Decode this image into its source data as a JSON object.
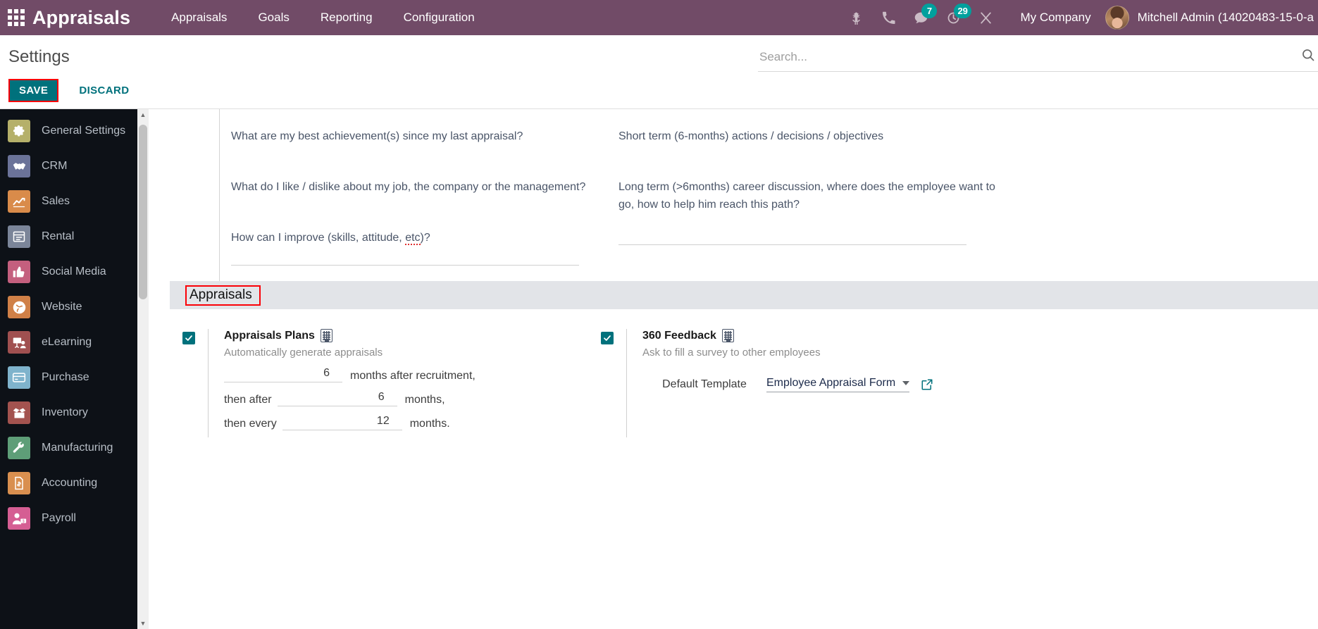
{
  "navbar": {
    "apps_icon": "apps-grid-icon",
    "brand": "Appraisals",
    "menu": [
      {
        "label": "Appraisals"
      },
      {
        "label": "Goals"
      },
      {
        "label": "Reporting"
      },
      {
        "label": "Configuration"
      }
    ],
    "sys_icons": [
      {
        "name": "bug-icon",
        "badge": null
      },
      {
        "name": "phone-icon",
        "badge": null
      },
      {
        "name": "chat-icon",
        "badge": "7"
      },
      {
        "name": "activity-clock-icon",
        "badge": "29"
      },
      {
        "name": "developer-tools-icon",
        "badge": null
      }
    ],
    "company": "My Company",
    "user": "Mitchell Admin (14020483-15-0-a",
    "accent_color": "#714B67",
    "badge_color": "#00A09D"
  },
  "control_panel": {
    "title": "Settings",
    "save_label": "SAVE",
    "discard_label": "DISCARD",
    "save_highlight_color": "#fb0007",
    "save_button_color": "#00717c",
    "search": {
      "placeholder": "Search...",
      "value": "",
      "icon": "search-icon"
    }
  },
  "sidebar": {
    "items": [
      {
        "label": "General Settings",
        "icon": "gear-icon",
        "color": "#b5b06a"
      },
      {
        "label": "CRM",
        "icon": "handshake-icon",
        "color": "#6b7399"
      },
      {
        "label": "Sales",
        "icon": "chart-up-icon",
        "color": "#d98b4a"
      },
      {
        "label": "Rental",
        "icon": "calendar-list-icon",
        "color": "#7b8599"
      },
      {
        "label": "Social Media",
        "icon": "thumbs-up-icon",
        "color": "#c45f7e"
      },
      {
        "label": "Website",
        "icon": "globe-icon",
        "color": "#d08047"
      },
      {
        "label": "eLearning",
        "icon": "presentation-icon",
        "color": "#a05050"
      },
      {
        "label": "Purchase",
        "icon": "credit-card-icon",
        "color": "#7fb3cc"
      },
      {
        "label": "Inventory",
        "icon": "box-open-icon",
        "color": "#a3534f"
      },
      {
        "label": "Manufacturing",
        "icon": "wrench-icon",
        "color": "#5e9e78"
      },
      {
        "label": "Accounting",
        "icon": "invoice-dollar-icon",
        "color": "#d98f4f"
      },
      {
        "label": "Payroll",
        "icon": "user-dollar-icon",
        "color": "#d55e93"
      }
    ]
  },
  "appraisal_questions": {
    "left": [
      "What are my best achievement(s) since my last appraisal?",
      "What do I like / dislike about my job, the company or the management?",
      "How can I improve (skills, attitude, etc)?"
    ],
    "right": [
      "Short term (6-months) actions / decisions / objectives",
      "Long term (>6months) career discussion, where does the employee want to go, how to help him reach this path?"
    ]
  },
  "section": {
    "title": "Appraisals",
    "highlight_color": "#fb0007"
  },
  "settings": {
    "appraisals_plans": {
      "checked": true,
      "title": "Appraisals Plans",
      "company_icon": "company-building-icon",
      "description": "Automatically generate appraisals",
      "row1": {
        "value": "6",
        "suffix": "months after recruitment,"
      },
      "row2": {
        "prefix": "then after",
        "value": "6",
        "suffix": "months,"
      },
      "row3": {
        "prefix": "then every",
        "value": "12",
        "suffix": "months."
      }
    },
    "feedback_360": {
      "checked": true,
      "title": "360 Feedback",
      "company_icon": "company-building-icon",
      "description": "Ask to fill a survey to other employees",
      "template_label": "Default Template",
      "template_value": "Employee Appraisal Form",
      "dropdown_icon": "chevron-down-icon",
      "external_icon": "external-link-icon"
    }
  }
}
